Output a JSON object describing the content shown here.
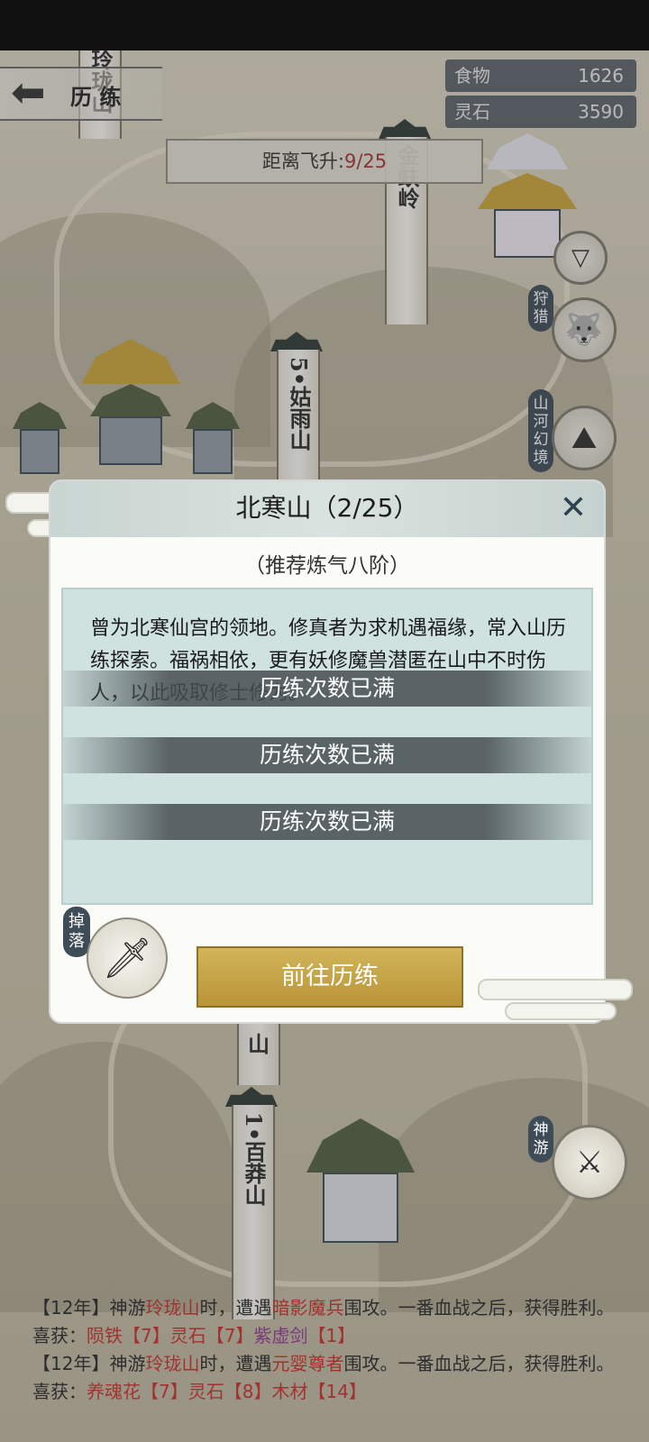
{
  "header": {
    "back_title": "历 练",
    "resources": [
      {
        "label": "食物",
        "value": "1626"
      },
      {
        "label": "灵石",
        "value": "3590"
      }
    ],
    "ascend_label": "距离飞升:",
    "ascend_value": "9/25"
  },
  "map": {
    "pillars": [
      {
        "text": "玲珑山"
      },
      {
        "text": "金蚨岭"
      },
      {
        "text": "5•姑雨山"
      },
      {
        "text": "1•百莽山"
      },
      {
        "text": "山"
      }
    ]
  },
  "side_menu": [
    {
      "label": "狩猎",
      "icon": "wolf-icon"
    },
    {
      "label": "山河幻境",
      "icon": "mountain-river-icon"
    },
    {
      "label": "神游",
      "icon": "spirit-sword-icon"
    }
  ],
  "dialog": {
    "title": "北寒山（2/25）",
    "close": "✕",
    "subtitle": "（推荐炼气八阶）",
    "description": "曾为北寒仙宫的领地。修真者为求机遇福缘，常入山历练探索。福祸相依，更有妖修魔兽潜匿在山中不时伤人，以此吸取修士修为。",
    "banners": [
      "历练次数已满",
      "历练次数已满",
      "历练次数已满"
    ],
    "drop_label": "掉落",
    "go_button": "前往历练"
  },
  "log": [
    {
      "a": "【12年】神游",
      "place": "玲珑山",
      "b": "时，遭遇",
      "enemy": "暗影魔兵",
      "c": "围攻。一番血战之后，获得胜利。喜获：",
      "items": [
        {
          "name": "陨铁",
          "count": "【7】",
          "cls": "r"
        },
        {
          "name": "灵石",
          "count": "【7】",
          "cls": "r"
        },
        {
          "name": "紫虚剑",
          "count": "【1】",
          "cls": "p"
        }
      ]
    },
    {
      "a": "【12年】神游",
      "place": "玲珑山",
      "b": "时，遭遇",
      "enemy": "元婴尊者",
      "c": "围攻。一番血战之后，获得胜利。喜获：",
      "items": [
        {
          "name": "养魂花",
          "count": "【7】",
          "cls": "r"
        },
        {
          "name": "灵石",
          "count": "【8】",
          "cls": "r"
        },
        {
          "name": "木材",
          "count": "【14】",
          "cls": "r"
        }
      ]
    }
  ]
}
